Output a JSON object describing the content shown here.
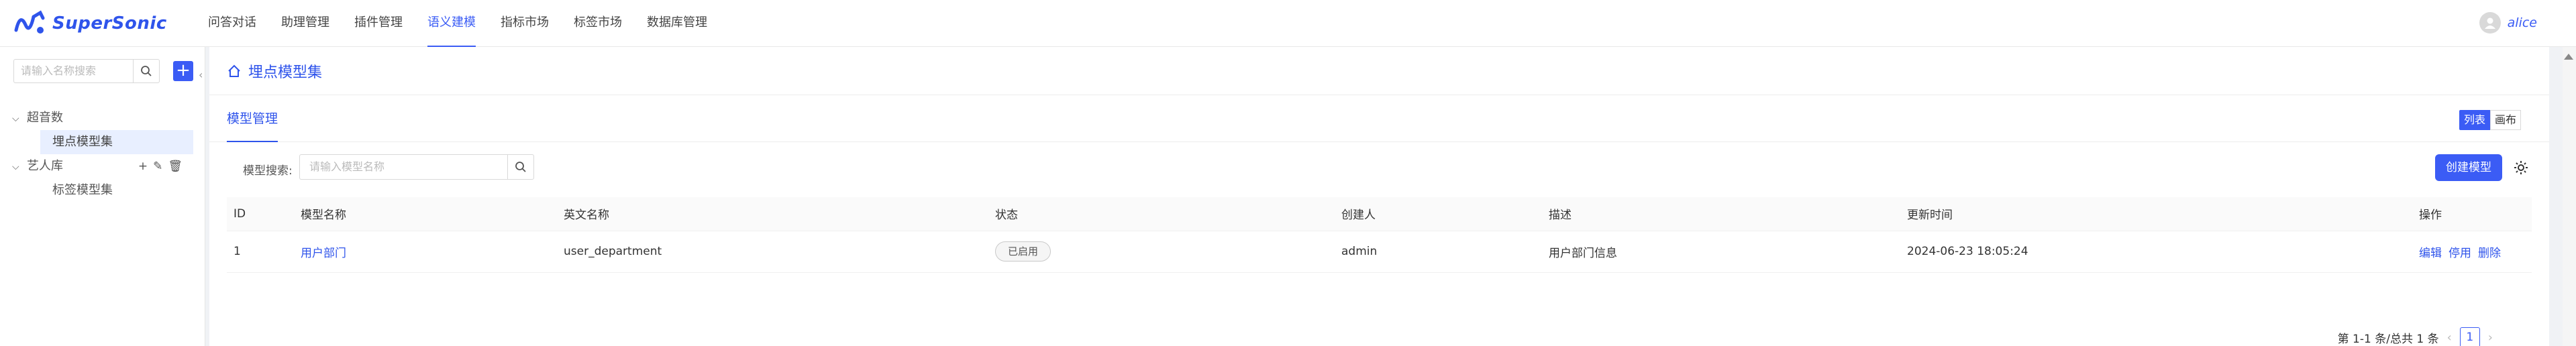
{
  "app": {
    "name": "SuperSonic",
    "user": "alice"
  },
  "nav": [
    {
      "label": "问答对话",
      "active": false
    },
    {
      "label": "助理管理",
      "active": false
    },
    {
      "label": "插件管理",
      "active": false
    },
    {
      "label": "语义建模",
      "active": true
    },
    {
      "label": "指标市场",
      "active": false
    },
    {
      "label": "标签市场",
      "active": false
    },
    {
      "label": "数据库管理",
      "active": false
    }
  ],
  "sidebar": {
    "search_placeholder": "请输入名称搜索",
    "tree": [
      {
        "label": "超音数",
        "expanded": true,
        "children": [
          {
            "label": "埋点模型集",
            "selected": true
          }
        ]
      },
      {
        "label": "艺人库",
        "expanded": true,
        "children": [
          {
            "label": "标签模型集",
            "selected": false
          }
        ]
      }
    ]
  },
  "page": {
    "title": "埋点模型集",
    "tab": "模型管理",
    "view_toggle": {
      "list": "列表",
      "canvas": "画布",
      "active": "列表"
    },
    "search_label": "模型搜索:",
    "search_placeholder": "请输入模型名称",
    "create_button": "创建模型"
  },
  "table": {
    "columns": [
      "ID",
      "模型名称",
      "英文名称",
      "状态",
      "创建人",
      "描述",
      "更新时间",
      "操作"
    ],
    "rows": [
      {
        "id": "1",
        "name": "用户部门",
        "en_name": "user_department",
        "status": "已启用",
        "creator": "admin",
        "desc": "用户部门信息",
        "updated": "2024-06-23 18:05:24",
        "actions": [
          "编辑",
          "停用",
          "删除"
        ]
      }
    ]
  },
  "pagination": {
    "summary": "第 1-1 条/总共 1 条",
    "current": "1"
  },
  "colors": {
    "primary": "#3b5cf5",
    "link": "#2f54eb"
  }
}
